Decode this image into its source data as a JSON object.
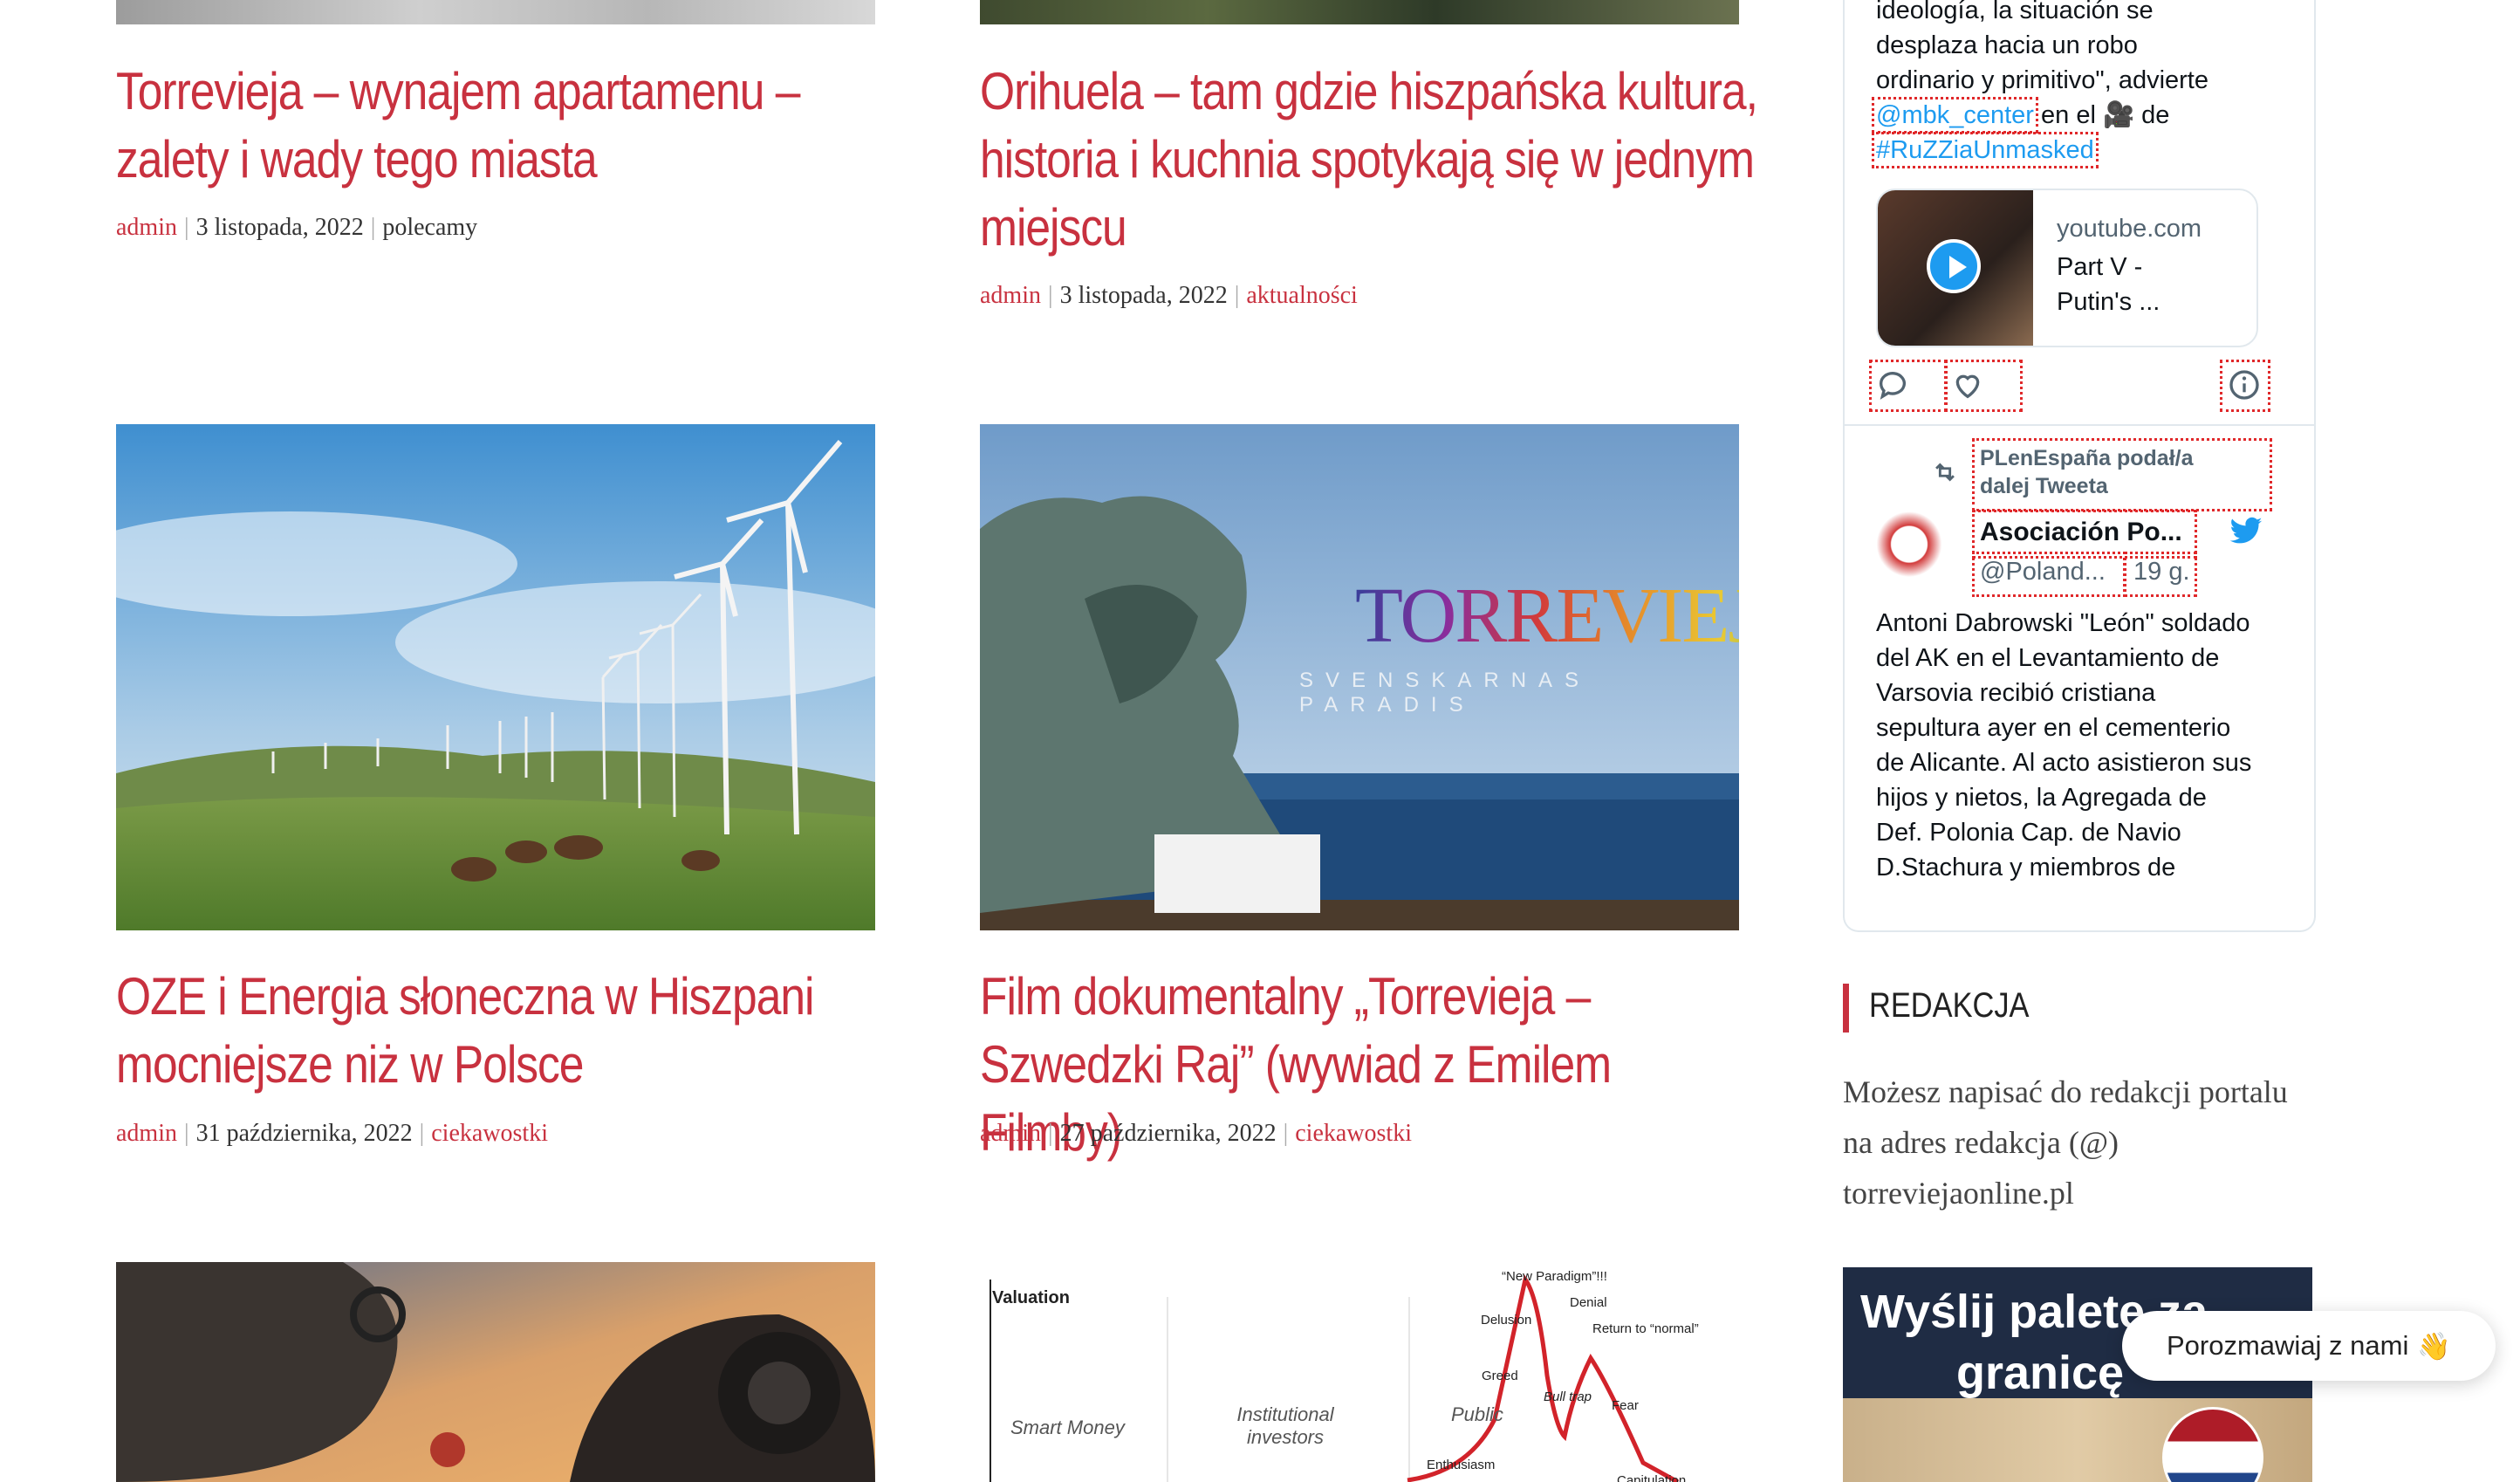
{
  "posts": [
    {
      "title": "Torrevieja – wynajem apartamenu – zalety i wady tego miasta",
      "author": "admin",
      "date": "3 listopada, 2022",
      "category": "polecamy"
    },
    {
      "title": "Orihuela – tam gdzie hiszpańska kultura, historia i kuchnia spotykają się w jednym miejscu",
      "author": "admin",
      "date": "3 listopada, 2022",
      "category": "aktualności"
    },
    {
      "title": "OZE i Energia słoneczna w Hiszpani mocniejsze niż w Polsce",
      "author": "admin",
      "date": "31 października, 2022",
      "category": "ciekawostki"
    },
    {
      "title": "Film dokumentalny „Torrevieja – Szwedzki Raj” (wywiad z Emilem Filmby)",
      "author": "admin",
      "date": "27 października, 2022",
      "category": "ciekawostki"
    }
  ],
  "images": {
    "torrevieja_logo": "TORREVIEJA",
    "torrevieja_sub": "SVENSKARNAS PARADIS",
    "chart_labels": {
      "valuation": "Valuation",
      "smart_money": "Smart Money",
      "institutional": "Institutional investors",
      "public": "Public",
      "new_paradigm": "“New Paradigm”!!!",
      "denial": "Denial",
      "delusion": "Delusion",
      "return_normal": "Return to “normal”",
      "greed": "Greed",
      "bull_trap": "Bull trap",
      "fear": "Fear",
      "enthusiasm": "Enthusiasm",
      "capitulation": "Capitulation"
    }
  },
  "twitter": {
    "line1": "ideología, la situación se",
    "line2": "desplaza hacia un robo",
    "line3": "ordinario y primitivo\", advierte",
    "mention": "@mbk_center",
    "line4_mid": "en el",
    "line4_end": "de",
    "hashtag": "#RuZZiaUnmasked",
    "card_domain": "youtube.com",
    "card_title_1": "Part V -",
    "card_title_2": "Putin's ...",
    "retweet_label_1": "PLenEspaña podał/a",
    "retweet_label_2": "dalej Tweeta",
    "author_name": "Asociación Po...",
    "author_handle": "@Poland...",
    "author_time": "19 g.",
    "tweet_text": "Antoni Dabrowski \"León\" soldado del AK en el Levantamiento de Varsovia recibió cristiana sepultura ayer en el cementerio de Alicante. Al acto asistieron sus hijos y nietos, la Agregada de Def. Polonia Cap. de Navio D.Stachura y miembros de"
  },
  "redakcja": {
    "heading": "REDAKCJA",
    "text": "Możesz napisać do redakcji portalu na adres redakcja (@) torreviejaonline.pl"
  },
  "banner": {
    "text_1": "Wyślij paletę za",
    "text_2": "granicę"
  },
  "chat": {
    "label": "Porozmawiaj z nami",
    "emoji": "👋"
  },
  "colors": {
    "accent": "#c8313f",
    "twitter_blue": "#1d9bf0"
  }
}
